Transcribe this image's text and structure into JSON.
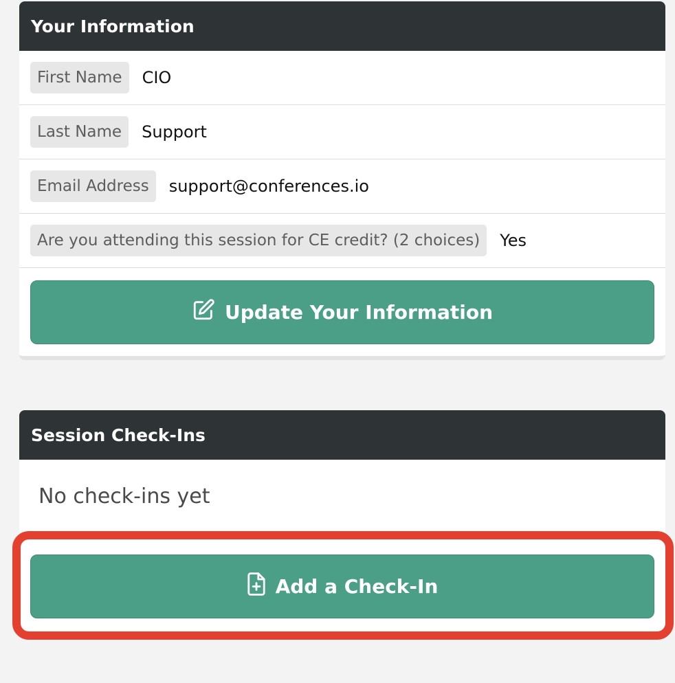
{
  "info_card": {
    "title": "Your Information",
    "fields": [
      {
        "label": "First Name",
        "value": "CIO"
      },
      {
        "label": "Last Name",
        "value": "Support"
      },
      {
        "label": "Email Address",
        "value": "support@conferences.io"
      },
      {
        "label": "Are you attending this session for CE credit? (2 choices)",
        "value": "Yes"
      }
    ],
    "update_button_label": "Update Your Information",
    "update_button_icon": "edit-icon"
  },
  "checkins_card": {
    "title": "Session Check-Ins",
    "empty_text": "No check-ins yet",
    "add_button_label": "Add a Check-In",
    "add_button_icon": "file-plus-icon"
  },
  "colors": {
    "header_bg": "#2e3336",
    "button_bg": "#4a9f86",
    "highlight": "#e4402f",
    "page_bg": "#f3f3f3"
  }
}
